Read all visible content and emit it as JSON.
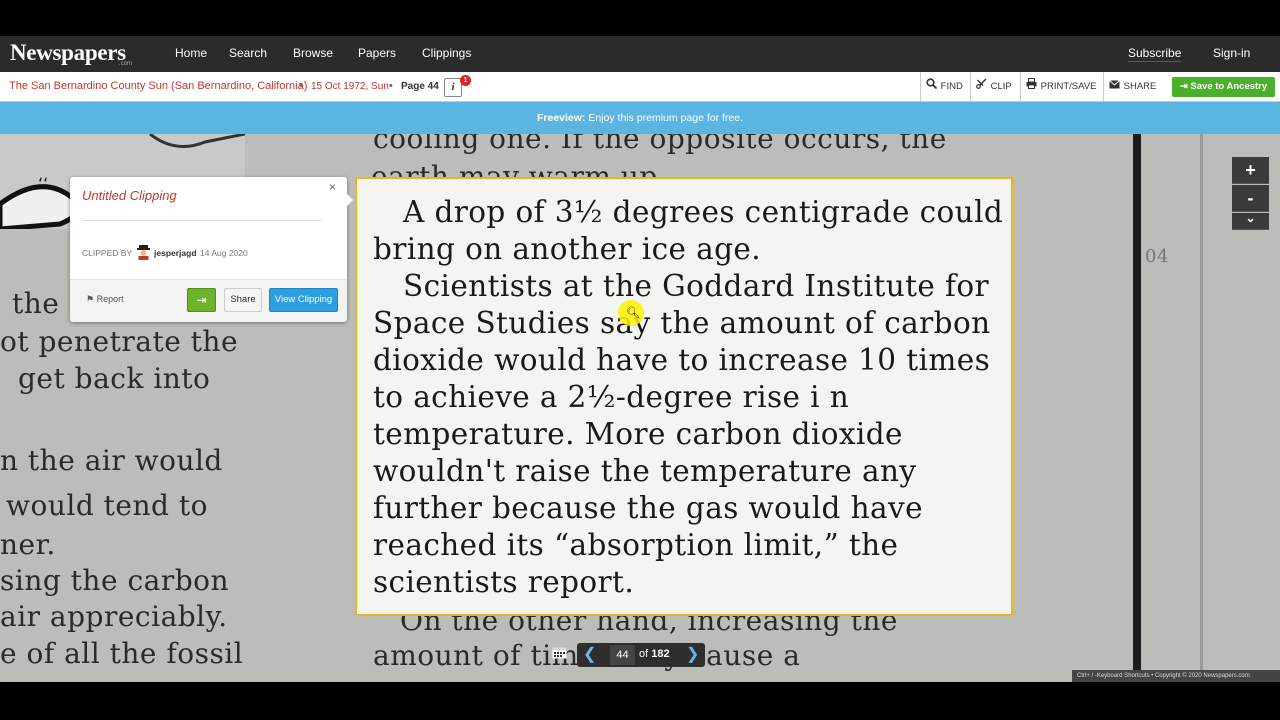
{
  "nav": {
    "logo": "Newspapers",
    "logo_sub": ".com",
    "links": [
      "Home",
      "Search",
      "Browse",
      "Papers",
      "Clippings"
    ],
    "subscribe": "Subscribe",
    "signin": "Sign-in"
  },
  "toolbar": {
    "paper": "The San Bernardino County Sun (San Bernardino, California)",
    "separator": "•",
    "date": "15 Oct 1972, Sun",
    "page": "Page 44",
    "info_icon": "i",
    "info_badge": "1",
    "find": "FIND",
    "clip": "CLIP",
    "print_save": "PRINT/SAVE",
    "share": "SHARE",
    "ancestry": "Save to Ancestry"
  },
  "banner": {
    "label": "Freeview:",
    "text": "Enjoy this premium page for free."
  },
  "clipping": {
    "title": "Untitled Clipping",
    "close": "×",
    "clipped_by_label": "CLIPPED BY",
    "user": "jesperjagd",
    "date": "14 Aug 2020",
    "report": "Report",
    "share": "Share",
    "view": "View Clipping"
  },
  "article": {
    "above": [
      "cooling one. If the opposite occurs, the",
      "earth may warm up."
    ],
    "clip_lines": [
      "A drop of 3½ degrees centigrade could",
      "bring on another ice age.",
      "Scientists at the Goddard Institute for",
      "Space Studies say the amount of carbon",
      "dioxide would have to increase 10 times",
      "to  achieve  a  2½-degree  rise  i n",
      "temperature.  More  carbon  dioxide",
      "wouldn't  raise  the  temperature  any",
      "further because the gas would have",
      "reached  its  “absorption  limit,”  the",
      "scientists report."
    ],
    "below": [
      "On  the  other  hand,  increasing  the",
      "amount of        times may cause a"
    ],
    "left_column": [
      "the",
      "ot penetrate the",
      "get back into",
      "n the air would",
      "would tend to",
      "ner.",
      "sing the carbon",
      "air appreciably.",
      "e of all the fossil"
    ],
    "right_fragment": "04"
  },
  "pager": {
    "current": "44",
    "of_label": "of",
    "total": "182"
  },
  "zoom": {
    "plus": "+",
    "minus": "-",
    "more": "⌄"
  },
  "footer": "Ctrl+ /   -Keyboard Shortcuts • Copyright © 2020 Newspapers.com",
  "icons": {
    "find": "magnifier-icon",
    "clip": "scissors-icon",
    "print": "printer-icon",
    "share": "envelope-icon"
  }
}
